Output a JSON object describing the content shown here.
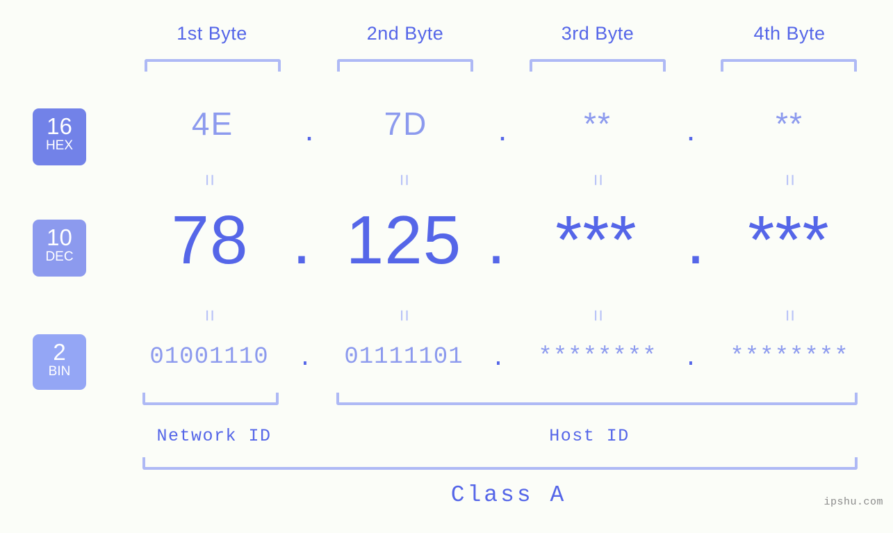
{
  "background_color": "#fbfdf8",
  "colors": {
    "strong": "#5566e8",
    "mid": "#8c9aee",
    "light": "#aeb9f5",
    "badge_hex": "#7282e8",
    "badge_dec": "#8c9aee",
    "badge_bin": "#94a6f5",
    "watermark": "#8a8a8a"
  },
  "byte_headers": [
    {
      "label": "1st Byte"
    },
    {
      "label": "2nd Byte"
    },
    {
      "label": "3rd Byte"
    },
    {
      "label": "4th Byte"
    }
  ],
  "badges": [
    {
      "number": "16",
      "name": "HEX"
    },
    {
      "number": "10",
      "name": "DEC"
    },
    {
      "number": "2",
      "name": "BIN"
    }
  ],
  "rows": {
    "hex": {
      "base": "16",
      "base_name": "HEX",
      "values": [
        "4E",
        "7D",
        "**",
        "**"
      ],
      "separator": "."
    },
    "dec": {
      "base": "10",
      "base_name": "DEC",
      "values": [
        "78",
        "125",
        "***",
        "***"
      ],
      "separator": "."
    },
    "bin": {
      "base": "2",
      "base_name": "BIN",
      "values": [
        "01001110",
        "01111101",
        "********",
        "********"
      ],
      "separator": "."
    }
  },
  "equals_glyph": "=",
  "id_labels": [
    {
      "label": "Network ID"
    },
    {
      "label": "Host ID"
    }
  ],
  "class_label": "Class A",
  "watermark": "ipshu.com"
}
